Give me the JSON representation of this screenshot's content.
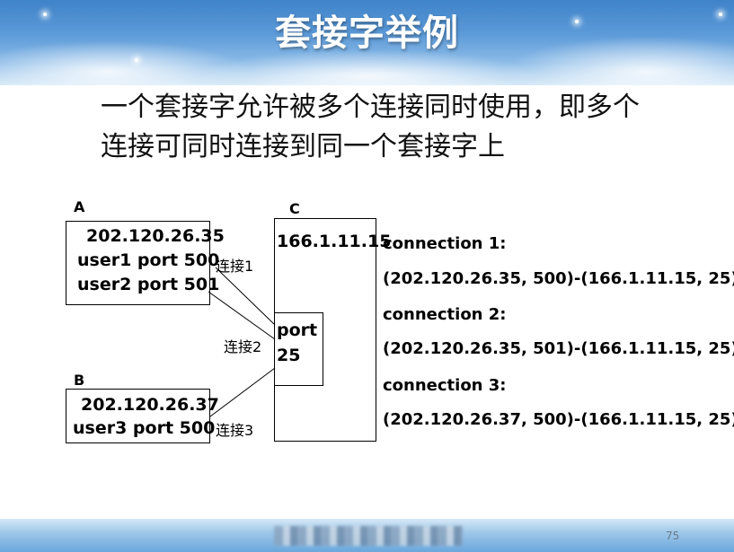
{
  "slide": {
    "title": "套接字举例",
    "intro_line1": "一个套接字允许被多个连接同时使用，即多个",
    "intro_line2": "连接可同时连接到同一个套接字上",
    "page_number": "75"
  },
  "diagram": {
    "host_a": {
      "label": "A",
      "ip": "202.120.26.35",
      "line1": "user1 port 500",
      "line2": "user2 port 501"
    },
    "host_b": {
      "label": "B",
      "ip": "202.120.26.37",
      "line1": "user3 port 500"
    },
    "host_c": {
      "label": "C",
      "ip": "166.1.11.15",
      "port_word": "port",
      "port_num": "25"
    },
    "links": [
      "连接1",
      "连接2",
      "连接3"
    ]
  },
  "connections": [
    {
      "name": "connection 1:",
      "tuple": "(202.120.26.35, 500)-(166.1.11.15, 25)"
    },
    {
      "name": "connection 2:",
      "tuple": "(202.120.26.35, 501)-(166.1.11.15, 25)"
    },
    {
      "name": "connection 3:",
      "tuple": "(202.120.26.37, 500)-(166.1.11.15, 25)"
    }
  ]
}
